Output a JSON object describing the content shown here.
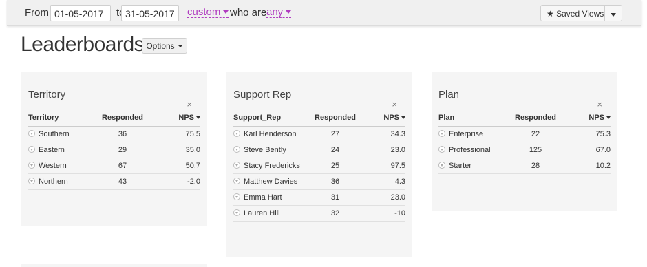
{
  "filter": {
    "from_label": "From",
    "from_date": "01-05-2017",
    "to_label": "to",
    "to_date": "31-05-2017",
    "range_option": "custom",
    "who_label": "who are",
    "who_option": "any",
    "saved_views_label": "Saved Views"
  },
  "page": {
    "title": "Leaderboards",
    "options_label": "Options"
  },
  "colors": {
    "link_accent": "#b03cc0",
    "panel_bg": "#f5f5f5"
  },
  "panels": [
    {
      "title": "Territory",
      "close": "×",
      "headers": [
        "Territory",
        "Responded",
        "NPS"
      ],
      "rows": [
        {
          "name": "Southern",
          "responded": "36",
          "nps": "75.5"
        },
        {
          "name": "Eastern",
          "responded": "29",
          "nps": "35.0"
        },
        {
          "name": "Western",
          "responded": "67",
          "nps": "50.7"
        },
        {
          "name": "Northern",
          "responded": "43",
          "nps": "-2.0"
        }
      ]
    },
    {
      "title": "Support Rep",
      "close": "×",
      "headers": [
        "Support_Rep",
        "Responded",
        "NPS"
      ],
      "rows": [
        {
          "name": "Karl Henderson",
          "responded": "27",
          "nps": "34.3"
        },
        {
          "name": "Steve Bently",
          "responded": "24",
          "nps": "23.0"
        },
        {
          "name": "Stacy Fredericks",
          "responded": "25",
          "nps": "97.5"
        },
        {
          "name": "Matthew Davies",
          "responded": "36",
          "nps": "4.3"
        },
        {
          "name": "Emma Hart",
          "responded": "31",
          "nps": "23.0"
        },
        {
          "name": "Lauren Hill",
          "responded": "32",
          "nps": "-10"
        }
      ]
    },
    {
      "title": "Plan",
      "close": "×",
      "headers": [
        "Plan",
        "Responded",
        "NPS"
      ],
      "rows": [
        {
          "name": "Enterprise",
          "responded": "22",
          "nps": "75.3"
        },
        {
          "name": "Professional",
          "responded": "125",
          "nps": "67.0"
        },
        {
          "name": "Starter",
          "responded": "28",
          "nps": "10.2"
        }
      ]
    }
  ]
}
